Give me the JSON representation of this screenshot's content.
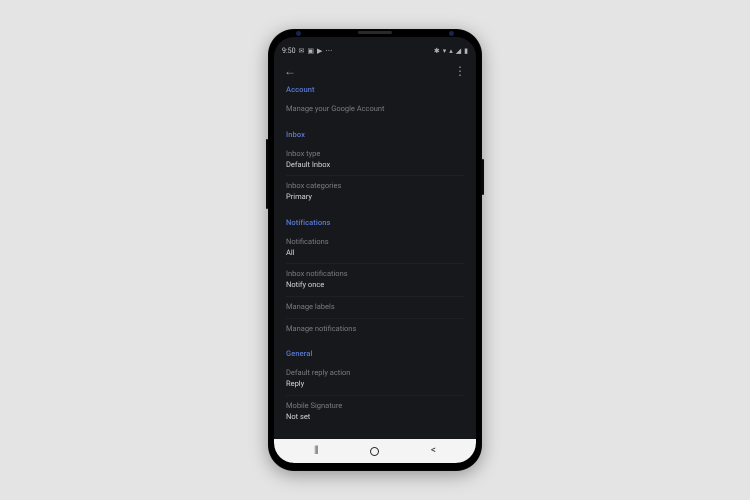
{
  "statusbar": {
    "time": "9:50",
    "left_icons": [
      "✉",
      "▣",
      "▶",
      "⋯"
    ],
    "right_icons": [
      "✱",
      "▾",
      "▴",
      "◢",
      "▮"
    ]
  },
  "appbar": {
    "back": "←",
    "overflow": "⋮"
  },
  "sections": [
    {
      "header": "Account",
      "rows": [
        {
          "title": "Manage your Google Account",
          "value": null
        }
      ]
    },
    {
      "header": "Inbox",
      "rows": [
        {
          "title": "Inbox type",
          "value": "Default Inbox"
        },
        {
          "title": "Inbox categories",
          "value": "Primary"
        }
      ]
    },
    {
      "header": "Notifications",
      "rows": [
        {
          "title": "Notifications",
          "value": "All"
        },
        {
          "title": "Inbox notifications",
          "value": "Notify once"
        },
        {
          "title": "Manage labels",
          "value": null
        },
        {
          "title": "Manage notifications",
          "value": null
        }
      ]
    },
    {
      "header": "General",
      "rows": [
        {
          "title": "Default reply action",
          "value": "Reply"
        },
        {
          "title": "Mobile Signature",
          "value": "Not set"
        }
      ]
    }
  ],
  "navbar": {
    "recent": "|||",
    "back": "<"
  }
}
